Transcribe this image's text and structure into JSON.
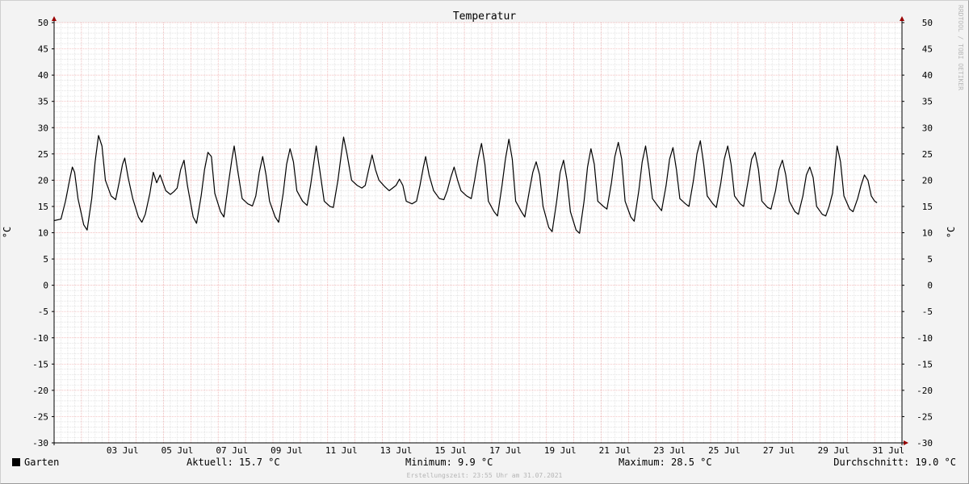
{
  "chart_data": {
    "type": "line",
    "title": "Temperatur",
    "ylabel": "°C",
    "ylim": [
      -30,
      50
    ],
    "yticks": [
      -30,
      -25,
      -20,
      -15,
      -10,
      -5,
      0,
      5,
      10,
      15,
      20,
      25,
      30,
      35,
      40,
      45,
      50
    ],
    "xlim": [
      "2021-07-01",
      "2021-07-31"
    ],
    "xticks": [
      {
        "x": "2021-07-03",
        "label": "03 Jul"
      },
      {
        "x": "2021-07-05",
        "label": "05 Jul"
      },
      {
        "x": "2021-07-07",
        "label": "07 Jul"
      },
      {
        "x": "2021-07-09",
        "label": "09 Jul"
      },
      {
        "x": "2021-07-11",
        "label": "11 Jul"
      },
      {
        "x": "2021-07-13",
        "label": "13 Jul"
      },
      {
        "x": "2021-07-15",
        "label": "15 Jul"
      },
      {
        "x": "2021-07-17",
        "label": "17 Jul"
      },
      {
        "x": "2021-07-19",
        "label": "19 Jul"
      },
      {
        "x": "2021-07-21",
        "label": "21 Jul"
      },
      {
        "x": "2021-07-23",
        "label": "23 Jul"
      },
      {
        "x": "2021-07-25",
        "label": "25 Jul"
      },
      {
        "x": "2021-07-27",
        "label": "27 Jul"
      },
      {
        "x": "2021-07-29",
        "label": "29 Jul"
      },
      {
        "x": "2021-07-31",
        "label": "31 Jul"
      }
    ],
    "grid": true,
    "series": [
      {
        "name": "Garten",
        "color": "#000000",
        "points": [
          [
            "2021-07-01 00:00",
            12.3
          ],
          [
            "2021-07-01 06:00",
            12.6
          ],
          [
            "2021-07-01 10:00",
            16.0
          ],
          [
            "2021-07-01 14:00",
            20.5
          ],
          [
            "2021-07-01 16:00",
            22.5
          ],
          [
            "2021-07-01 18:00",
            21.5
          ],
          [
            "2021-07-01 21:00",
            16.5
          ],
          [
            "2021-07-02 02:00",
            11.5
          ],
          [
            "2021-07-02 05:00",
            10.5
          ],
          [
            "2021-07-02 09:00",
            16.5
          ],
          [
            "2021-07-02 12:00",
            23.5
          ],
          [
            "2021-07-02 15:00",
            28.5
          ],
          [
            "2021-07-02 18:00",
            26.5
          ],
          [
            "2021-07-02 21:00",
            20.0
          ],
          [
            "2021-07-03 02:00",
            17.0
          ],
          [
            "2021-07-03 06:00",
            16.3
          ],
          [
            "2021-07-03 09:00",
            19.5
          ],
          [
            "2021-07-03 12:00",
            23.0
          ],
          [
            "2021-07-03 14:00",
            24.2
          ],
          [
            "2021-07-03 17:00",
            20.5
          ],
          [
            "2021-07-03 21:00",
            16.5
          ],
          [
            "2021-07-04 02:00",
            13.0
          ],
          [
            "2021-07-04 05:00",
            12.0
          ],
          [
            "2021-07-04 08:00",
            13.5
          ],
          [
            "2021-07-04 12:00",
            17.5
          ],
          [
            "2021-07-04 15:00",
            21.5
          ],
          [
            "2021-07-04 18:00",
            19.5
          ],
          [
            "2021-07-04 21:00",
            21.0
          ],
          [
            "2021-07-05 02:00",
            18.0
          ],
          [
            "2021-07-05 06:00",
            17.3
          ],
          [
            "2021-07-05 09:00",
            17.8
          ],
          [
            "2021-07-05 12:00",
            18.5
          ],
          [
            "2021-07-05 15:00",
            22.0
          ],
          [
            "2021-07-05 18:00",
            23.8
          ],
          [
            "2021-07-05 21:00",
            19.0
          ],
          [
            "2021-07-06 02:00",
            13.0
          ],
          [
            "2021-07-06 05:00",
            11.8
          ],
          [
            "2021-07-06 09:00",
            17.0
          ],
          [
            "2021-07-06 12:00",
            22.0
          ],
          [
            "2021-07-06 15:00",
            25.3
          ],
          [
            "2021-07-06 18:00",
            24.5
          ],
          [
            "2021-07-06 21:00",
            17.5
          ],
          [
            "2021-07-07 02:00",
            14.0
          ],
          [
            "2021-07-07 05:00",
            13.0
          ],
          [
            "2021-07-07 09:00",
            19.5
          ],
          [
            "2021-07-07 12:00",
            24.0
          ],
          [
            "2021-07-07 14:00",
            26.5
          ],
          [
            "2021-07-07 17:00",
            22.0
          ],
          [
            "2021-07-07 21:00",
            16.5
          ],
          [
            "2021-07-08 02:00",
            15.5
          ],
          [
            "2021-07-08 06:00",
            15.1
          ],
          [
            "2021-07-08 09:00",
            17.0
          ],
          [
            "2021-07-08 12:00",
            21.5
          ],
          [
            "2021-07-08 15:00",
            24.5
          ],
          [
            "2021-07-08 18:00",
            21.0
          ],
          [
            "2021-07-08 21:00",
            16.0
          ],
          [
            "2021-07-09 02:00",
            13.0
          ],
          [
            "2021-07-09 05:00",
            12.0
          ],
          [
            "2021-07-09 09:00",
            17.5
          ],
          [
            "2021-07-09 12:00",
            23.0
          ],
          [
            "2021-07-09 15:00",
            26.0
          ],
          [
            "2021-07-09 18:00",
            23.5
          ],
          [
            "2021-07-09 21:00",
            18.0
          ],
          [
            "2021-07-10 02:00",
            16.0
          ],
          [
            "2021-07-10 06:00",
            15.2
          ],
          [
            "2021-07-10 09:00",
            19.0
          ],
          [
            "2021-07-10 12:00",
            23.5
          ],
          [
            "2021-07-10 14:00",
            26.5
          ],
          [
            "2021-07-10 17:00",
            22.0
          ],
          [
            "2021-07-10 21:00",
            16.0
          ],
          [
            "2021-07-11 02:00",
            15.0
          ],
          [
            "2021-07-11 05:00",
            14.8
          ],
          [
            "2021-07-11 09:00",
            20.0
          ],
          [
            "2021-07-11 12:00",
            25.0
          ],
          [
            "2021-07-11 14:00",
            28.2
          ],
          [
            "2021-07-11 17:00",
            25.0
          ],
          [
            "2021-07-11 21:00",
            20.0
          ],
          [
            "2021-07-12 02:00",
            19.0
          ],
          [
            "2021-07-12 06:00",
            18.5
          ],
          [
            "2021-07-12 09:00",
            19.0
          ],
          [
            "2021-07-12 12:00",
            22.0
          ],
          [
            "2021-07-12 15:00",
            24.8
          ],
          [
            "2021-07-12 18:00",
            22.0
          ],
          [
            "2021-07-12 21:00",
            20.0
          ],
          [
            "2021-07-13 02:00",
            18.8
          ],
          [
            "2021-07-13 06:00",
            18.0
          ],
          [
            "2021-07-13 09:00",
            18.5
          ],
          [
            "2021-07-13 12:00",
            19.0
          ],
          [
            "2021-07-13 15:00",
            20.2
          ],
          [
            "2021-07-13 18:00",
            19.0
          ],
          [
            "2021-07-13 21:00",
            16.0
          ],
          [
            "2021-07-14 02:00",
            15.5
          ],
          [
            "2021-07-14 06:00",
            16.0
          ],
          [
            "2021-07-14 09:00",
            19.0
          ],
          [
            "2021-07-14 12:00",
            22.5
          ],
          [
            "2021-07-14 14:00",
            24.5
          ],
          [
            "2021-07-14 17:00",
            21.0
          ],
          [
            "2021-07-14 21:00",
            18.0
          ],
          [
            "2021-07-15 02:00",
            16.5
          ],
          [
            "2021-07-15 06:00",
            16.3
          ],
          [
            "2021-07-15 09:00",
            18.0
          ],
          [
            "2021-07-15 12:00",
            20.5
          ],
          [
            "2021-07-15 15:00",
            22.5
          ],
          [
            "2021-07-15 18:00",
            20.0
          ],
          [
            "2021-07-15 21:00",
            18.0
          ],
          [
            "2021-07-16 02:00",
            17.0
          ],
          [
            "2021-07-16 06:00",
            16.5
          ],
          [
            "2021-07-16 09:00",
            20.0
          ],
          [
            "2021-07-16 12:00",
            24.0
          ],
          [
            "2021-07-16 15:00",
            27.0
          ],
          [
            "2021-07-16 18:00",
            23.0
          ],
          [
            "2021-07-16 21:00",
            16.0
          ],
          [
            "2021-07-17 02:00",
            14.0
          ],
          [
            "2021-07-17 05:00",
            13.2
          ],
          [
            "2021-07-17 09:00",
            19.0
          ],
          [
            "2021-07-17 12:00",
            24.0
          ],
          [
            "2021-07-17 15:00",
            27.8
          ],
          [
            "2021-07-17 18:00",
            24.0
          ],
          [
            "2021-07-17 21:00",
            16.0
          ],
          [
            "2021-07-18 02:00",
            14.0
          ],
          [
            "2021-07-18 05:00",
            13.0
          ],
          [
            "2021-07-18 09:00",
            18.0
          ],
          [
            "2021-07-18 12:00",
            21.5
          ],
          [
            "2021-07-18 15:00",
            23.5
          ],
          [
            "2021-07-18 18:00",
            21.0
          ],
          [
            "2021-07-18 21:00",
            15.0
          ],
          [
            "2021-07-19 02:00",
            11.0
          ],
          [
            "2021-07-19 05:00",
            10.2
          ],
          [
            "2021-07-19 09:00",
            16.0
          ],
          [
            "2021-07-19 12:00",
            21.5
          ],
          [
            "2021-07-19 15:00",
            23.8
          ],
          [
            "2021-07-19 18:00",
            20.0
          ],
          [
            "2021-07-19 21:00",
            14.0
          ],
          [
            "2021-07-20 02:00",
            10.5
          ],
          [
            "2021-07-20 05:00",
            9.9
          ],
          [
            "2021-07-20 09:00",
            16.0
          ],
          [
            "2021-07-20 12:00",
            22.5
          ],
          [
            "2021-07-20 15:00",
            26.0
          ],
          [
            "2021-07-20 18:00",
            23.0
          ],
          [
            "2021-07-20 21:00",
            16.0
          ],
          [
            "2021-07-21 02:00",
            15.0
          ],
          [
            "2021-07-21 05:00",
            14.5
          ],
          [
            "2021-07-21 09:00",
            19.5
          ],
          [
            "2021-07-21 12:00",
            24.5
          ],
          [
            "2021-07-21 15:00",
            27.2
          ],
          [
            "2021-07-21 18:00",
            24.0
          ],
          [
            "2021-07-21 21:00",
            16.0
          ],
          [
            "2021-07-22 02:00",
            13.0
          ],
          [
            "2021-07-22 05:00",
            12.2
          ],
          [
            "2021-07-22 09:00",
            18.0
          ],
          [
            "2021-07-22 12:00",
            23.5
          ],
          [
            "2021-07-22 15:00",
            26.5
          ],
          [
            "2021-07-22 18:00",
            22.0
          ],
          [
            "2021-07-22 21:00",
            16.5
          ],
          [
            "2021-07-23 02:00",
            15.0
          ],
          [
            "2021-07-23 05:00",
            14.2
          ],
          [
            "2021-07-23 09:00",
            19.0
          ],
          [
            "2021-07-23 12:00",
            24.0
          ],
          [
            "2021-07-23 15:00",
            26.2
          ],
          [
            "2021-07-23 18:00",
            22.0
          ],
          [
            "2021-07-23 21:00",
            16.5
          ],
          [
            "2021-07-24 02:00",
            15.5
          ],
          [
            "2021-07-24 05:00",
            15.0
          ],
          [
            "2021-07-24 09:00",
            20.0
          ],
          [
            "2021-07-24 12:00",
            25.0
          ],
          [
            "2021-07-24 15:00",
            27.5
          ],
          [
            "2021-07-24 18:00",
            23.0
          ],
          [
            "2021-07-24 21:00",
            17.0
          ],
          [
            "2021-07-25 02:00",
            15.5
          ],
          [
            "2021-07-25 05:00",
            14.8
          ],
          [
            "2021-07-25 09:00",
            19.5
          ],
          [
            "2021-07-25 12:00",
            24.0
          ],
          [
            "2021-07-25 15:00",
            26.5
          ],
          [
            "2021-07-25 18:00",
            23.0
          ],
          [
            "2021-07-25 21:00",
            17.0
          ],
          [
            "2021-07-26 02:00",
            15.5
          ],
          [
            "2021-07-26 05:00",
            15.0
          ],
          [
            "2021-07-26 09:00",
            20.0
          ],
          [
            "2021-07-26 12:00",
            24.0
          ],
          [
            "2021-07-26 15:00",
            25.3
          ],
          [
            "2021-07-26 18:00",
            22.0
          ],
          [
            "2021-07-26 21:00",
            16.0
          ],
          [
            "2021-07-27 02:00",
            14.8
          ],
          [
            "2021-07-27 05:00",
            14.5
          ],
          [
            "2021-07-27 09:00",
            18.0
          ],
          [
            "2021-07-27 12:00",
            22.0
          ],
          [
            "2021-07-27 15:00",
            23.8
          ],
          [
            "2021-07-27 18:00",
            21.0
          ],
          [
            "2021-07-27 21:00",
            16.0
          ],
          [
            "2021-07-28 02:00",
            14.0
          ],
          [
            "2021-07-28 05:00",
            13.5
          ],
          [
            "2021-07-28 09:00",
            17.0
          ],
          [
            "2021-07-28 12:00",
            21.0
          ],
          [
            "2021-07-28 15:00",
            22.5
          ],
          [
            "2021-07-28 18:00",
            20.5
          ],
          [
            "2021-07-28 21:00",
            15.0
          ],
          [
            "2021-07-29 02:00",
            13.5
          ],
          [
            "2021-07-29 05:00",
            13.2
          ],
          [
            "2021-07-29 08:00",
            15.0
          ],
          [
            "2021-07-29 11:00",
            17.5
          ],
          [
            "2021-07-29 15:00",
            26.5
          ],
          [
            "2021-07-29 18:00",
            23.5
          ],
          [
            "2021-07-29 21:00",
            17.0
          ],
          [
            "2021-07-30 02:00",
            14.5
          ],
          [
            "2021-07-30 05:00",
            14.0
          ],
          [
            "2021-07-30 09:00",
            16.5
          ],
          [
            "2021-07-30 12:00",
            19.0
          ],
          [
            "2021-07-30 15:00",
            21.0
          ],
          [
            "2021-07-30 18:00",
            20.0
          ],
          [
            "2021-07-30 21:00",
            17.0
          ],
          [
            "2021-07-31 00:00",
            16.0
          ],
          [
            "2021-07-31 02:00",
            15.7
          ]
        ]
      }
    ]
  },
  "legend": {
    "series_name": "Garten",
    "current": "Aktuell: 15.7 °C",
    "minimum": "Minimum: 9.9 °C",
    "maximum": "Maximum: 28.5 °C",
    "average": "Durchschnitt: 19.0 °C"
  },
  "watermark": "RRDTOOL / TOBI OETIKER",
  "footer": "Erstellungszeit: 23:55 Uhr am 31.07.2021",
  "colors": {
    "background": "#f3f3f3",
    "plot_background": "#ffffff",
    "major_grid": "#f0a8a8",
    "minor_grid": "#d4d4d4",
    "axis": "#000000",
    "arrow": "#990000",
    "line": "#000000"
  }
}
